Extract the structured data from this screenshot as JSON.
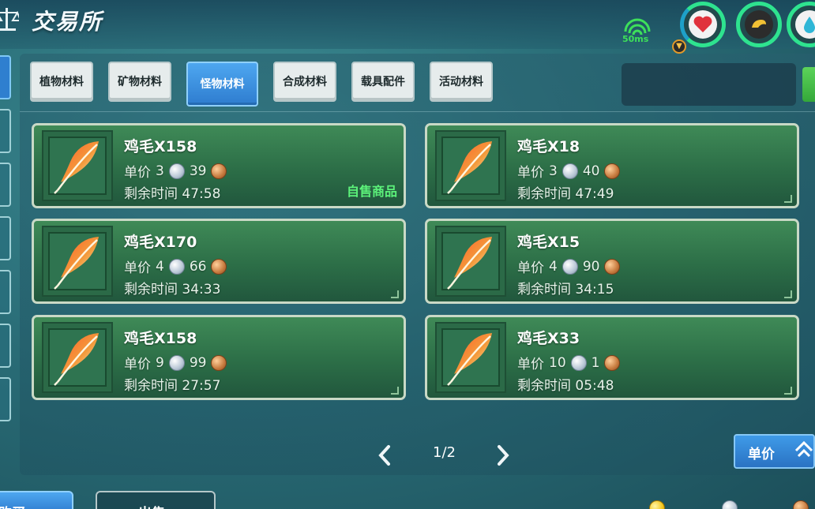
{
  "header": {
    "title": "交易所",
    "ping": "50ms",
    "icons": [
      "scale-icon",
      "signal-icon",
      "heart-icon",
      "pet-icon",
      "water-drop-icon"
    ]
  },
  "tabs": [
    {
      "label": "植物材料",
      "active": false
    },
    {
      "label": "矿物材料",
      "active": false
    },
    {
      "label": "怪物材料",
      "active": true
    },
    {
      "label": "合成材料",
      "active": false
    },
    {
      "label": "载具配件",
      "active": false
    },
    {
      "label": "活动材料",
      "active": false
    }
  ],
  "search": {
    "value": "",
    "placeholder": ""
  },
  "labels": {
    "price": "单价",
    "time": "剩余时间",
    "self_sale": "自售商品"
  },
  "listings": [
    {
      "name": "鸡毛X158",
      "silver": "3",
      "copper": "39",
      "time": "47:58",
      "self_sale": true
    },
    {
      "name": "鸡毛X18",
      "silver": "3",
      "copper": "40",
      "time": "47:49",
      "self_sale": false
    },
    {
      "name": "鸡毛X170",
      "silver": "4",
      "copper": "66",
      "time": "34:33",
      "self_sale": false
    },
    {
      "name": "鸡毛X15",
      "silver": "4",
      "copper": "90",
      "time": "34:15",
      "self_sale": false
    },
    {
      "name": "鸡毛X158",
      "silver": "9",
      "copper": "99",
      "time": "27:57",
      "self_sale": false
    },
    {
      "name": "鸡毛X33",
      "silver": "10",
      "copper": "1",
      "time": "05:48",
      "self_sale": false
    }
  ],
  "pager": {
    "text": "1/2"
  },
  "sort": {
    "label": "单价"
  },
  "bottom": {
    "buy_label": "购买",
    "sell_label": "出售"
  },
  "colors": {
    "accent_blue": "#2e7ccf",
    "card_green": "#2c6e47",
    "self_sale_green": "#5cf27a",
    "ring_green": "#2ee38f"
  }
}
